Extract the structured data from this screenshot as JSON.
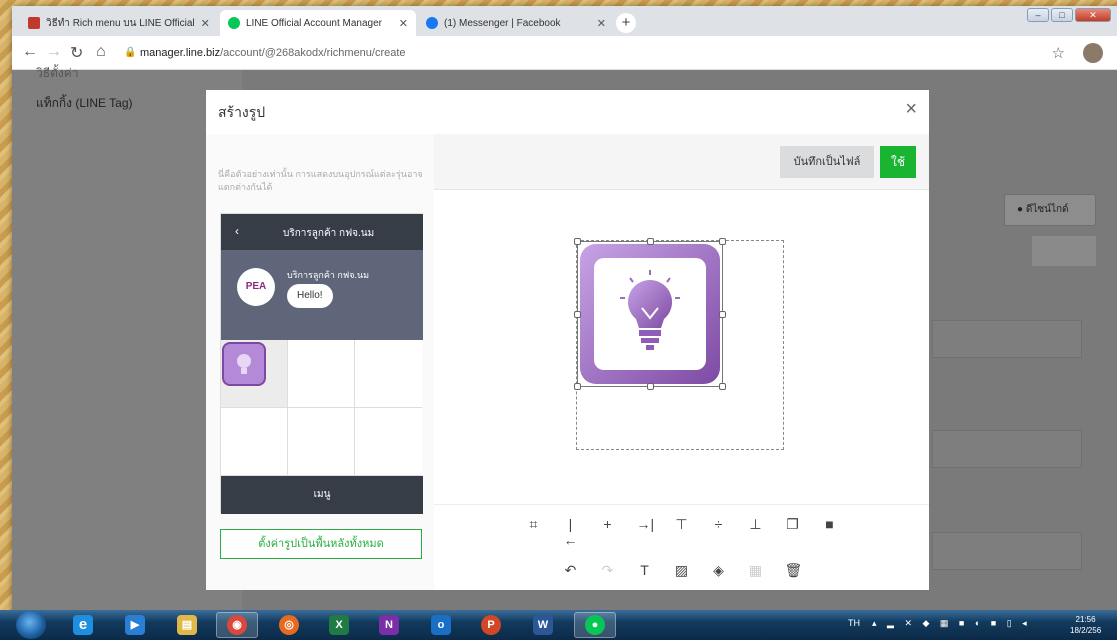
{
  "tabs": [
    {
      "label": "วิธีทำ Rich menu บน LINE Official",
      "color": "#c0392b"
    },
    {
      "label": "LINE Official Account Manager",
      "color": "#06c755"
    },
    {
      "label": "(1) Messenger | Facebook",
      "color": "#1877f2"
    }
  ],
  "newtab_label": "+",
  "window_buttons": {
    "minimize": "–",
    "maximize": "□",
    "close": "✕"
  },
  "address": {
    "host": "manager.line.biz",
    "path": "/account/@268akodx/richmenu/create"
  },
  "sidebar": {
    "item_top": "วิธีตั้งค่า",
    "item_line_tag": "แท็กกิ้ง (LINE Tag)"
  },
  "page_right": {
    "design_guide": "ดีไซน์ไกด์"
  },
  "modal": {
    "title": "สร้างรูป",
    "hint": "นี่คือตัวอย่างเท่านั้น การแสดงบนอุปกรณ์แต่ละรุ่นอาจแตกต่างกันได้",
    "phone": {
      "header": "บริการลูกค้า กฟจ.นม",
      "avatar_text": "PEA",
      "chat_name": "บริการลูกค้า กฟจ.นม",
      "bubble": "Hello!",
      "menu_label": "เมนู"
    },
    "set_background_button": "ตั้งค่ารูปเป็นพื้นหลังทั้งหมด",
    "save_file_button": "บันทึกเป็นไฟล์",
    "apply_button": "ใช้",
    "accent": "#19b532",
    "image_gradient": [
      "#b48ad8",
      "#7d4aa3"
    ]
  },
  "taskbar": {
    "apps": [
      {
        "name": "ie",
        "glyph": "e",
        "color": "#1e8fe0"
      },
      {
        "name": "media",
        "glyph": "▶",
        "color": "#2a7fd4"
      },
      {
        "name": "explorer",
        "glyph": "▤",
        "color": "#e0b84a"
      },
      {
        "name": "chrome",
        "glyph": "◉",
        "color": "#d9483b"
      },
      {
        "name": "firefox",
        "glyph": "◎",
        "color": "#e66a1f"
      },
      {
        "name": "excel",
        "glyph": "X",
        "color": "#1f7a43"
      },
      {
        "name": "onenote",
        "glyph": "N",
        "color": "#7b2fa6"
      },
      {
        "name": "outlook",
        "glyph": "o",
        "color": "#1a6fc4"
      },
      {
        "name": "powerpoint",
        "glyph": "P",
        "color": "#d24726"
      },
      {
        "name": "word",
        "glyph": "W",
        "color": "#2b5797"
      },
      {
        "name": "line",
        "glyph": "●",
        "color": "#06c755"
      }
    ],
    "language": "TH",
    "time": "21:56",
    "date": "18/2/256"
  }
}
